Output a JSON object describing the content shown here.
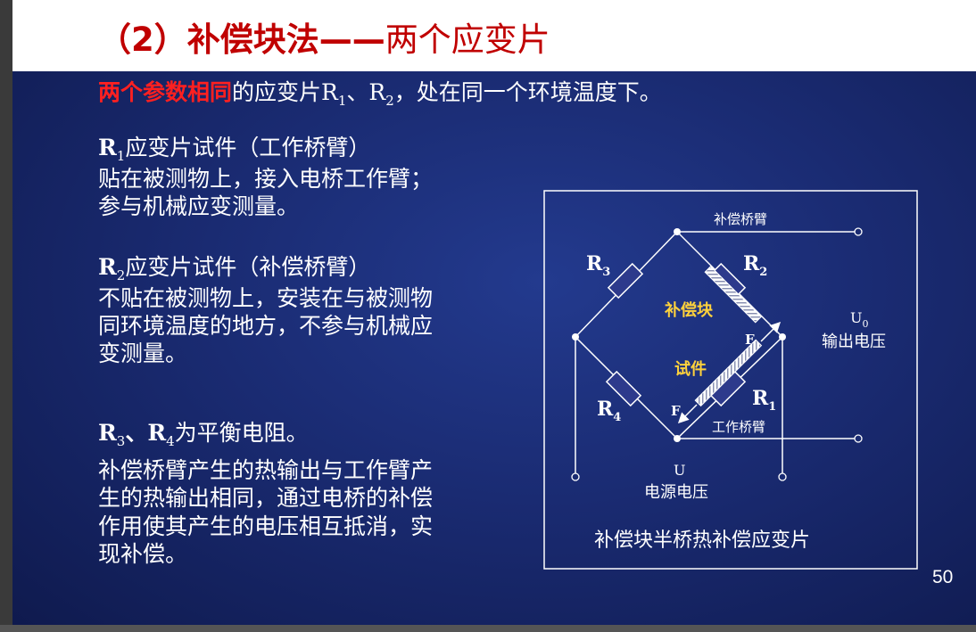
{
  "title": {
    "prefix": "（2）补偿块法——",
    "suffix": "两个应变片"
  },
  "intro": {
    "highlight": "两个参数相同",
    "rest_a": "的应变片R",
    "sub1": "1",
    "sep": "、R",
    "sub2": "2",
    "rest_b": "，处在同一个环境温度下。"
  },
  "r1": {
    "head_r": "R",
    "head_sub": "1",
    "head_text": "应变片试件（工作桥臂）",
    "line2": "贴在被测物上，接入电桥工作臂；",
    "line3": "参与机械应变测量。"
  },
  "r2": {
    "head_r": "R",
    "head_sub": "2",
    "head_text": "应变片试件（补偿桥臂）",
    "line2": "不贴在被测物上，安装在与被测物",
    "line3": "同环境温度的地方，不参与机械应",
    "line4": "变测量。"
  },
  "r34": {
    "a": "R",
    "a_sub": "3",
    "sep": "、R",
    "b_sub": "4",
    "text": "为平衡电阻。"
  },
  "conclusion": {
    "line1": "补偿桥臂产生的热输出与工作臂产",
    "line2": "生的热输出相同，通过电桥的补偿",
    "line3": "作用使其产生的电压相互抵消，实",
    "line4": "现补偿。"
  },
  "diagram": {
    "caption": "补偿块半桥热补偿应变片",
    "comp_arm": "补偿桥臂",
    "work_arm": "工作桥臂",
    "comp_block": "补偿块",
    "specimen": "试件",
    "force": "F",
    "r3": "R",
    "r3_sub": "3",
    "r2": "R",
    "r2_sub": "2",
    "r1": "R",
    "r1_sub": "1",
    "r4": "R",
    "r4_sub": "4",
    "out_u": "U",
    "out_sub": "0",
    "out_label": "输出电压",
    "supply_u": "U",
    "supply_label": "电源电压"
  },
  "page_number": "50"
}
